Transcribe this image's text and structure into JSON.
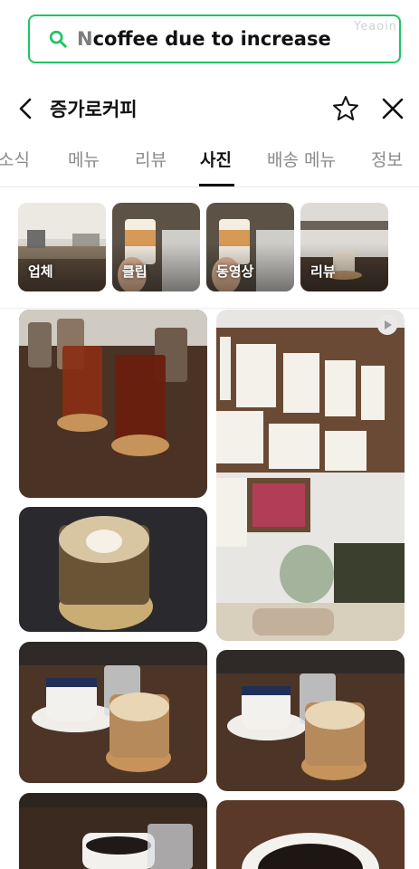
{
  "search": {
    "prefix": "N",
    "query": "coffee due to increase",
    "watermark": "Yeaoin"
  },
  "header": {
    "title": "증가로커피"
  },
  "tabs": [
    {
      "label": "소식"
    },
    {
      "label": "메뉴"
    },
    {
      "label": "리뷰"
    },
    {
      "label": "사진",
      "active": true
    },
    {
      "label": "배송 메뉴"
    },
    {
      "label": "정보"
    }
  ],
  "categories": [
    {
      "label": "업체"
    },
    {
      "label": "클립"
    },
    {
      "label": "동영상"
    },
    {
      "label": "리뷰"
    }
  ],
  "colors": {
    "accent": "#20c465",
    "tab_inactive": "#8a8a8a"
  },
  "icons": {
    "search": "search-icon",
    "back": "chevron-left-icon",
    "favorite": "star-outline-icon",
    "close": "close-icon",
    "video": "play-icon"
  }
}
